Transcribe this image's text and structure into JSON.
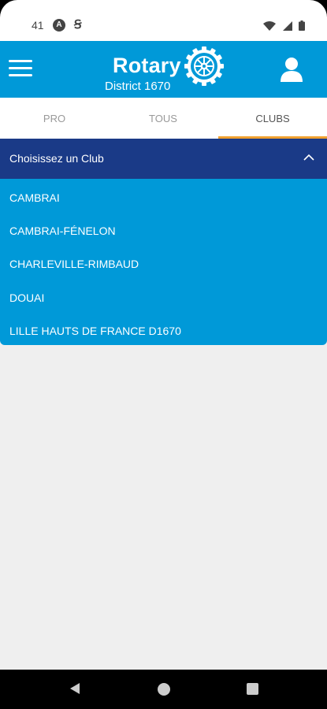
{
  "status_bar": {
    "time": "41",
    "icons": [
      "accessibility-a-icon",
      "s-icon",
      "wifi-icon",
      "signal-icon",
      "battery-icon"
    ]
  },
  "header": {
    "brand_name": "Rotary",
    "brand_sub": "District 1670",
    "colors": {
      "header_bg": "#0099d8",
      "text": "#ffffff"
    }
  },
  "tabs": {
    "items": [
      {
        "label": "PRO"
      },
      {
        "label": "TOUS"
      },
      {
        "label": "CLUBS"
      }
    ],
    "active": "CLUBS",
    "indicator_color": "#f0a030"
  },
  "club_selector": {
    "title": "Choisissez un Club",
    "expanded": true,
    "header_color": "#1a3a87",
    "list_color": "#0099d8",
    "clubs": [
      "CAMBRAI",
      "CAMBRAI-FÉNELON",
      "CHARLEVILLE-RIMBAUD",
      "DOUAI",
      "LILLE HAUTS DE FRANCE D1670"
    ]
  },
  "nav_bar": {
    "buttons": [
      "back-icon",
      "home-icon",
      "recents-icon"
    ]
  }
}
